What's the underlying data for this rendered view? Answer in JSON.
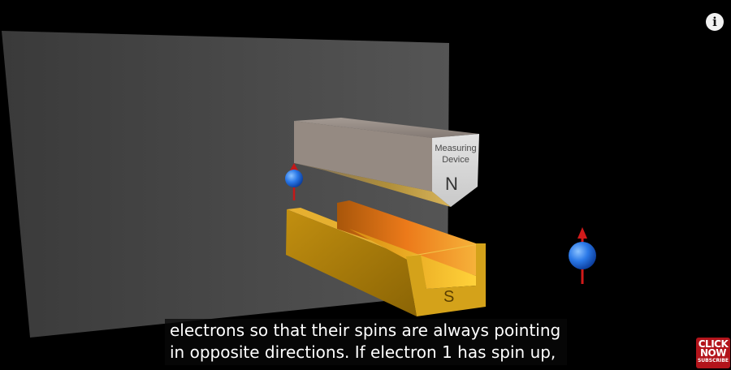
{
  "video": {
    "device_label_line1": "Measuring",
    "device_label_line2": "Device",
    "pole_north": "N",
    "pole_south": "S",
    "info_icon": "i"
  },
  "captions": {
    "line1": "electrons so that their spins are always pointing",
    "line2": "in opposite directions. If electron 1 has spin up,"
  },
  "subscribe": {
    "line1": "CLICK",
    "line2": "NOW",
    "line3": "SUBSCRIBE"
  },
  "colors": {
    "screen": "#4a4a4a",
    "magnet_gold": "#c99410",
    "electron": "#1f6ee0",
    "spin_arrow": "#d11a1a"
  }
}
